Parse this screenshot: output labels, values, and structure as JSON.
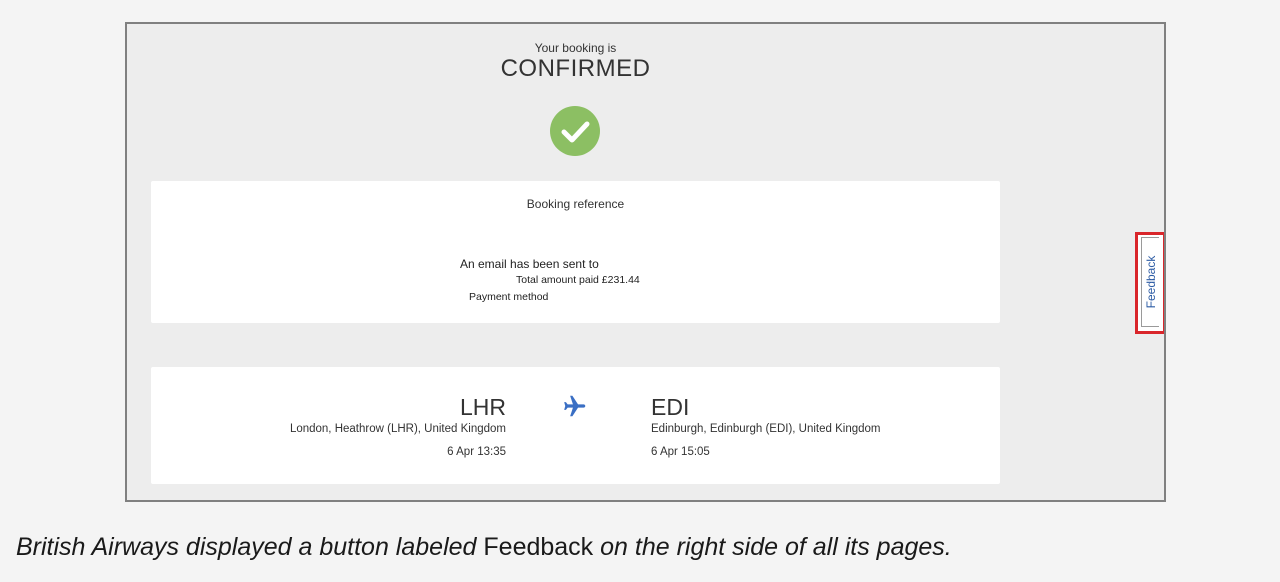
{
  "booking": {
    "status_intro": "Your booking is",
    "status": "CONFIRMED",
    "check_color": "#8cbf63"
  },
  "reference_card": {
    "reference_label": "Booking reference",
    "email_label": "An email has been sent to",
    "amount_label": "Total amount paid £231.44",
    "payment_label": "Payment method"
  },
  "flight": {
    "origin_code": "LHR",
    "origin_city": "London, Heathrow (LHR), United Kingdom",
    "origin_time": "6 Apr 13:35",
    "destination_code": "EDI",
    "destination_city": "Edinburgh, Edinburgh (EDI), United Kingdom",
    "destination_time": "6 Apr 15:05",
    "plane_icon": "airplane-icon",
    "plane_color": "#3a6fc4"
  },
  "feedback": {
    "label": "Feedback",
    "highlight_color": "#d9262b",
    "text_color": "#2d5ca5"
  },
  "caption": {
    "lead": "British Airways displayed a button labeled ",
    "keyword": "Feedback",
    "tail": " on the right side of all its pages."
  }
}
